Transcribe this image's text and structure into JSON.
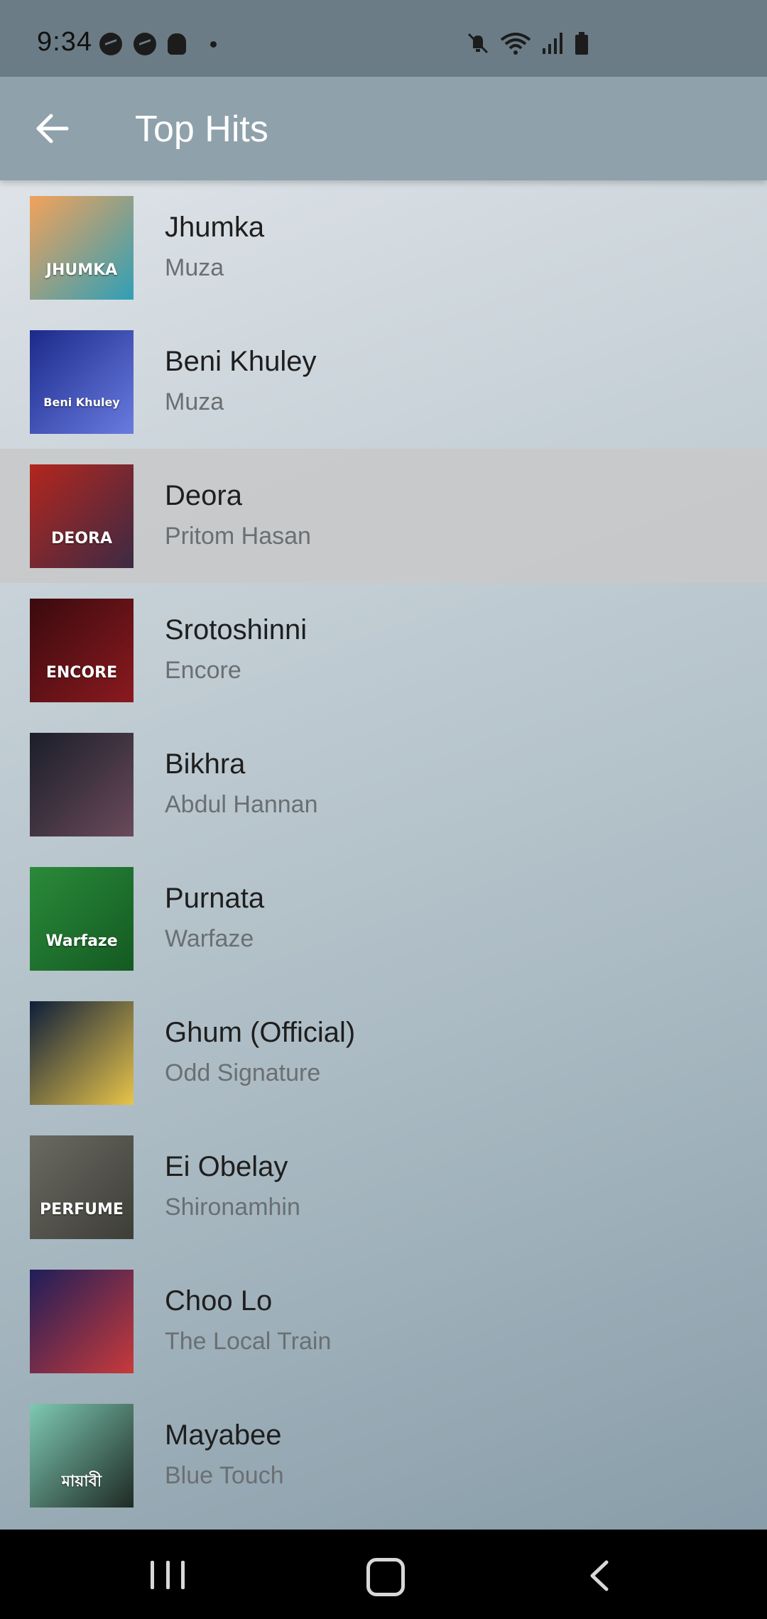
{
  "status_bar": {
    "time": "9:34",
    "left_icons": [
      "messenger-icon",
      "messenger-icon",
      "snapchat-icon",
      "dot-icon"
    ],
    "right_icons": [
      "mute-icon",
      "wifi-icon",
      "signal-icon",
      "battery-icon"
    ]
  },
  "app_bar": {
    "title": "Top Hits",
    "back_icon": "arrow-left-icon"
  },
  "songs": [
    {
      "title": "Jhumka",
      "artist": "Muza",
      "art_text": "JHUMKA",
      "art_colors": [
        "#f2a25a",
        "#2f9fb7"
      ]
    },
    {
      "title": "Beni Khuley",
      "artist": "Muza",
      "art_text": "Beni Khuley",
      "art_colors": [
        "#1b2a8a",
        "#6a7be0"
      ]
    },
    {
      "title": "Deora",
      "artist": "Pritom Hasan",
      "art_text": "DEORA",
      "art_colors": [
        "#b3261e",
        "#3c2a44"
      ]
    },
    {
      "title": "Srotoshinni",
      "artist": "Encore",
      "art_text": "ENCORE",
      "art_colors": [
        "#3a0a0e",
        "#8a1a1f"
      ]
    },
    {
      "title": "Bikhra",
      "artist": "Abdul Hannan",
      "art_text": "",
      "art_colors": [
        "#1a1e2a",
        "#6a4a5a"
      ]
    },
    {
      "title": "Purnata",
      "artist": "Warfaze",
      "art_text": "Warfaze",
      "art_colors": [
        "#2a8a3a",
        "#145a22"
      ]
    },
    {
      "title": "Ghum (Official)",
      "artist": "Odd Signature",
      "art_text": "",
      "art_colors": [
        "#0e1e3a",
        "#e8c44a"
      ]
    },
    {
      "title": "Ei Obelay",
      "artist": "Shironamhin",
      "art_text": "PERFUME",
      "art_colors": [
        "#6a6a62",
        "#3e3e38"
      ]
    },
    {
      "title": "Choo Lo",
      "artist": "The Local Train",
      "art_text": "",
      "art_colors": [
        "#1e1e5a",
        "#c83a3a"
      ]
    },
    {
      "title": "Mayabee",
      "artist": "Blue Touch",
      "art_text": "মায়াবী",
      "art_colors": [
        "#7ec9b3",
        "#1e2a24"
      ]
    }
  ],
  "highlighted_index": 2,
  "nav_bar": {
    "buttons": [
      "recents-icon",
      "home-icon",
      "back-icon"
    ]
  }
}
